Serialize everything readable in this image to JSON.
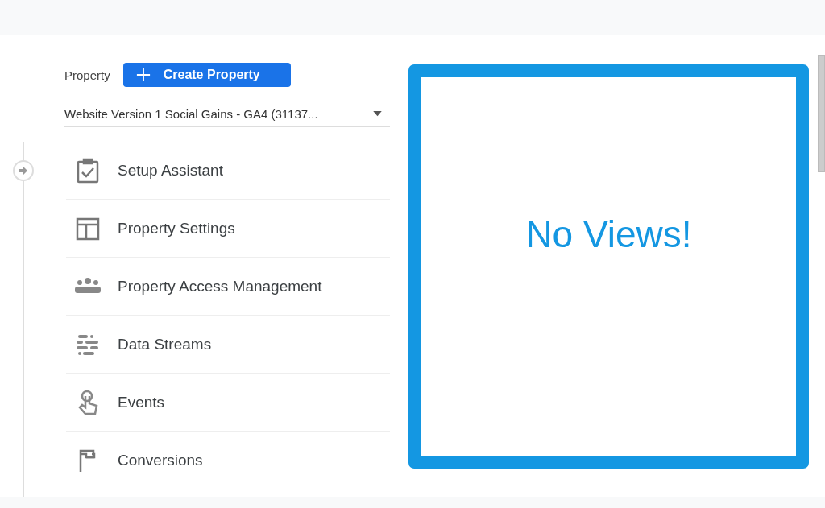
{
  "property": {
    "label": "Property",
    "create_button": "Create Property",
    "selector": {
      "value": "Website Version 1 Social Gains - GA4 (31137..."
    }
  },
  "menu": [
    {
      "label": "Setup Assistant"
    },
    {
      "label": "Property Settings"
    },
    {
      "label": "Property Access Management"
    },
    {
      "label": "Data Streams"
    },
    {
      "label": "Events"
    },
    {
      "label": "Conversions"
    }
  ],
  "views_panel": {
    "message": "No Views!"
  }
}
